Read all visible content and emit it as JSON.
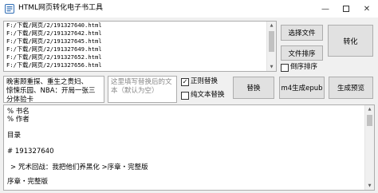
{
  "window": {
    "title": "HTML网页转化电子书工具",
    "minimize_icon": "minimize-icon",
    "maximize_icon": "maximize-icon",
    "close_icon": "close-icon"
  },
  "file_list": {
    "items": [
      "F:/下载/网页/2/191327640.html",
      "F:/下载/网页/2/191327642.html",
      "F:/下载/网页/2/191327645.html",
      "F:/下载/网页/2/191327649.html",
      "F:/下载/网页/2/191327652.html",
      "F:/下载/网页/2/191327656.html"
    ]
  },
  "buttons": {
    "select_files": "选择文件",
    "convert": "转化",
    "file_sort": "文件排序",
    "replace": "替换",
    "generate": "m4生成epub",
    "preview": "生成预览"
  },
  "checkboxes": {
    "reverse_sort": {
      "label": "倒序排序",
      "checked": false
    },
    "regex_replace": {
      "label": "正则替换",
      "checked": true
    },
    "plain_replace": {
      "label": "纯文本替换",
      "checked": false
    }
  },
  "find_text": {
    "lines": [
      "晚害顾重探、重生之贵妇、",
      "惊悚乐园、NBA：开局一张三",
      "分体验卡"
    ]
  },
  "replace_text": {
    "placeholder": "这里填写替换后的文本（默认为空）"
  },
  "content": {
    "lines": [
      "% 书名",
      "% 作者",
      "",
      "目录",
      "",
      "# 191327640",
      "",
      "> 咒术回战：我把他们养黑化 >序章・完整版",
      "",
      "序章・完整版"
    ]
  },
  "colors": {
    "accent": "#0078d7",
    "window_bg": "#f0f0f0"
  }
}
